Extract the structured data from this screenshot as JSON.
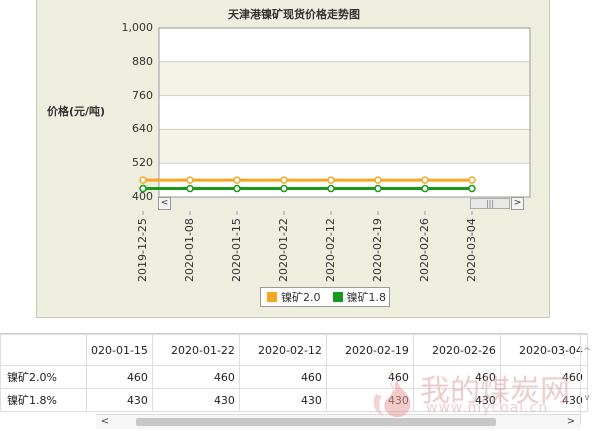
{
  "chart_data": {
    "type": "line",
    "title": "天津港镍矿现货价格走势图",
    "ylabel": "价格(元/吨)",
    "yticks": [
      "1,000",
      "880",
      "760",
      "640",
      "520",
      "400"
    ],
    "ytick_values": [
      1000,
      880,
      760,
      640,
      520,
      400
    ],
    "ylim": [
      400,
      1000
    ],
    "categories": [
      "2019-12-25",
      "2020-01-08",
      "2020-01-15",
      "2020-01-22",
      "2020-02-12",
      "2020-02-19",
      "2020-02-26",
      "2020-03-04"
    ],
    "series": [
      {
        "name": "镍矿2.0",
        "color": "#f5a623",
        "values": [
          460,
          460,
          460,
          460,
          460,
          460,
          460,
          460
        ]
      },
      {
        "name": "镍矿1.8",
        "color": "#1a9a1a",
        "values": [
          430,
          430,
          430,
          430,
          430,
          430,
          430,
          430
        ]
      }
    ],
    "grid": true,
    "legend": "bottom"
  },
  "scrollbar": {
    "left_arrow": "<",
    "right_arrow": ">",
    "thumb_grip": "|||"
  },
  "table": {
    "columns": [
      "020-01-15",
      "2020-01-22",
      "2020-02-12",
      "2020-02-19",
      "2020-02-26",
      "2020-03-04"
    ],
    "rows": [
      {
        "name": "镍矿2.0%",
        "values": [
          "460",
          "460",
          "460",
          "460",
          "460",
          "460"
        ]
      },
      {
        "name": "镍矿1.8%",
        "values": [
          "430",
          "430",
          "430",
          "430",
          "430",
          "430"
        ]
      }
    ],
    "hscroll": {
      "left": "<",
      "right": ">"
    },
    "vscroll": {
      "up": "^",
      "down": "v"
    }
  },
  "watermark": {
    "text": "我的煤炭网",
    "url": "www.mycoal.cn"
  }
}
